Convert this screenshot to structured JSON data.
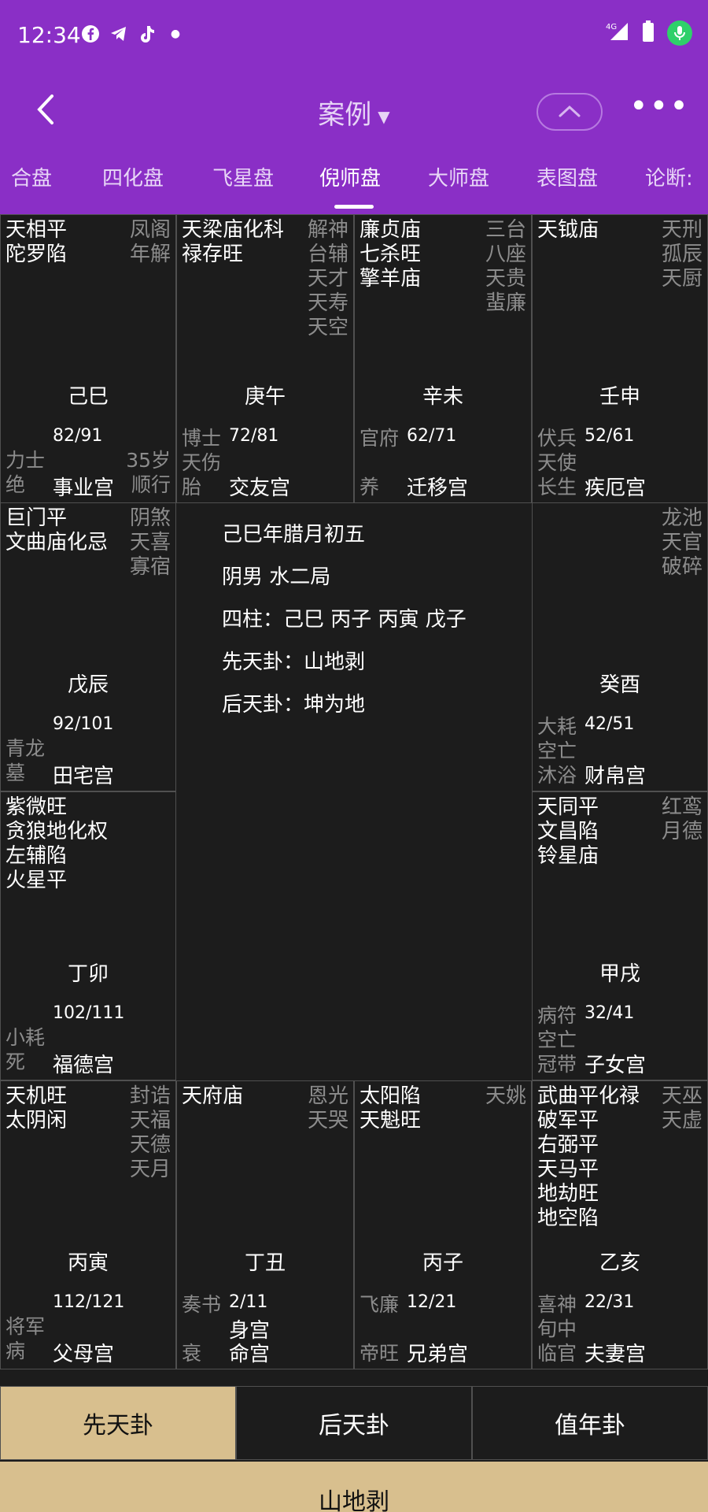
{
  "status": {
    "time": "12:34",
    "network": "4G"
  },
  "appbar": {
    "title": "案例"
  },
  "tabs": [
    "合盘",
    "四化盘",
    "飞星盘",
    "倪师盘",
    "大师盘",
    "表图盘",
    "论断:"
  ],
  "active_tab": "倪师盘",
  "palaces": [
    {
      "id": "si",
      "main": [
        "天相平",
        "陀罗陷"
      ],
      "minor": [
        "凤阁",
        "年解"
      ],
      "ganzhi": "己巳",
      "range": "82/91",
      "deity": "力士",
      "stage": "绝",
      "age": "35岁",
      "flow": "顺行",
      "palace": "事业宫"
    },
    {
      "id": "wu",
      "main": [
        "天梁庙化科",
        "禄存旺"
      ],
      "minor": [
        "解神",
        "台辅",
        "天才",
        "天寿",
        "天空"
      ],
      "ganzhi": "庚午",
      "range": "72/81",
      "deity": "博士",
      "star3": "天伤",
      "stage": "胎",
      "palace": "交友宫"
    },
    {
      "id": "wei",
      "main": [
        "廉贞庙",
        "七杀旺",
        "擎羊庙"
      ],
      "minor": [
        "三台",
        "八座",
        "天贵",
        "蜚廉"
      ],
      "ganzhi": "辛未",
      "range": "62/71",
      "deity": "官府",
      "stage": "养",
      "palace": "迁移宫"
    },
    {
      "id": "shen",
      "main": [
        "天钺庙"
      ],
      "minor": [
        "天刑",
        "孤辰",
        "天厨"
      ],
      "ganzhi": "壬申",
      "range": "52/61",
      "deity": "伏兵",
      "star3": "天使",
      "stage": "长生",
      "palace": "疾厄宫"
    },
    {
      "id": "chen",
      "main": [
        "巨门平",
        "文曲庙化忌"
      ],
      "minor": [
        "阴煞",
        "天喜",
        "寡宿"
      ],
      "ganzhi": "戊辰",
      "range": "92/101",
      "deity": "青龙",
      "stage": "墓",
      "palace": "田宅宫"
    },
    {
      "id": "you",
      "main": [],
      "minor": [
        "龙池",
        "天官",
        "破碎"
      ],
      "ganzhi": "癸酉",
      "range": "42/51",
      "deity": "大耗",
      "star3": "空亡",
      "stage": "沐浴",
      "palace": "财帛宫"
    },
    {
      "id": "mao",
      "main": [
        "紫微旺",
        "贪狼地化权",
        "左辅陷",
        "火星平"
      ],
      "minor": [],
      "ganzhi": "丁卯",
      "range": "102/111",
      "deity": "小耗",
      "stage": "死",
      "palace": "福德宫"
    },
    {
      "id": "xu",
      "main": [
        "天同平",
        "文昌陷",
        "铃星庙"
      ],
      "minor": [
        "红鸾",
        "月德"
      ],
      "ganzhi": "甲戌",
      "range": "32/41",
      "deity": "病符",
      "star3": "空亡",
      "stage": "冠带",
      "palace": "子女宫"
    },
    {
      "id": "yin",
      "main": [
        "天机旺",
        "太阴闲"
      ],
      "minor": [
        "封诰",
        "天福",
        "天德",
        "天月"
      ],
      "ganzhi": "丙寅",
      "range": "112/121",
      "deity": "将军",
      "stage": "病",
      "palace": "父母宫"
    },
    {
      "id": "chou",
      "main": [
        "天府庙"
      ],
      "minor": [
        "恩光",
        "天哭"
      ],
      "ganzhi": "丁丑",
      "range": "2/11",
      "deity": "奏书",
      "stage": "衰",
      "palace_top": "身宫",
      "palace": "命宫"
    },
    {
      "id": "zi",
      "main": [
        "太阳陷",
        "天魁旺"
      ],
      "minor": [
        "天姚"
      ],
      "ganzhi": "丙子",
      "range": "12/21",
      "deity": "飞廉",
      "stage": "帝旺",
      "palace": "兄弟宫"
    },
    {
      "id": "hai",
      "main": [
        "武曲平化禄",
        "破军平",
        "右弼平",
        "天马平",
        "地劫旺",
        "地空陷"
      ],
      "minor": [
        "天巫",
        "天虚"
      ],
      "ganzhi": "乙亥",
      "range": "22/31",
      "deity": "喜神",
      "star3": "旬中",
      "stage": "临官",
      "palace": "夫妻宫"
    }
  ],
  "center_info": [
    "己巳年腊月初五",
    "阴男  水二局",
    "四柱：己巳 丙子 丙寅 戊子",
    "先天卦：山地剥",
    "后天卦：坤为地"
  ],
  "bottom_tabs": [
    "先天卦",
    "后天卦",
    "值年卦"
  ],
  "active_bottom_tab": "先天卦",
  "hexagram_result": "山地剥",
  "colors": {
    "header": "#8a2fc6",
    "gold": "#d8bf8e",
    "bg": "#1c1c1c"
  }
}
